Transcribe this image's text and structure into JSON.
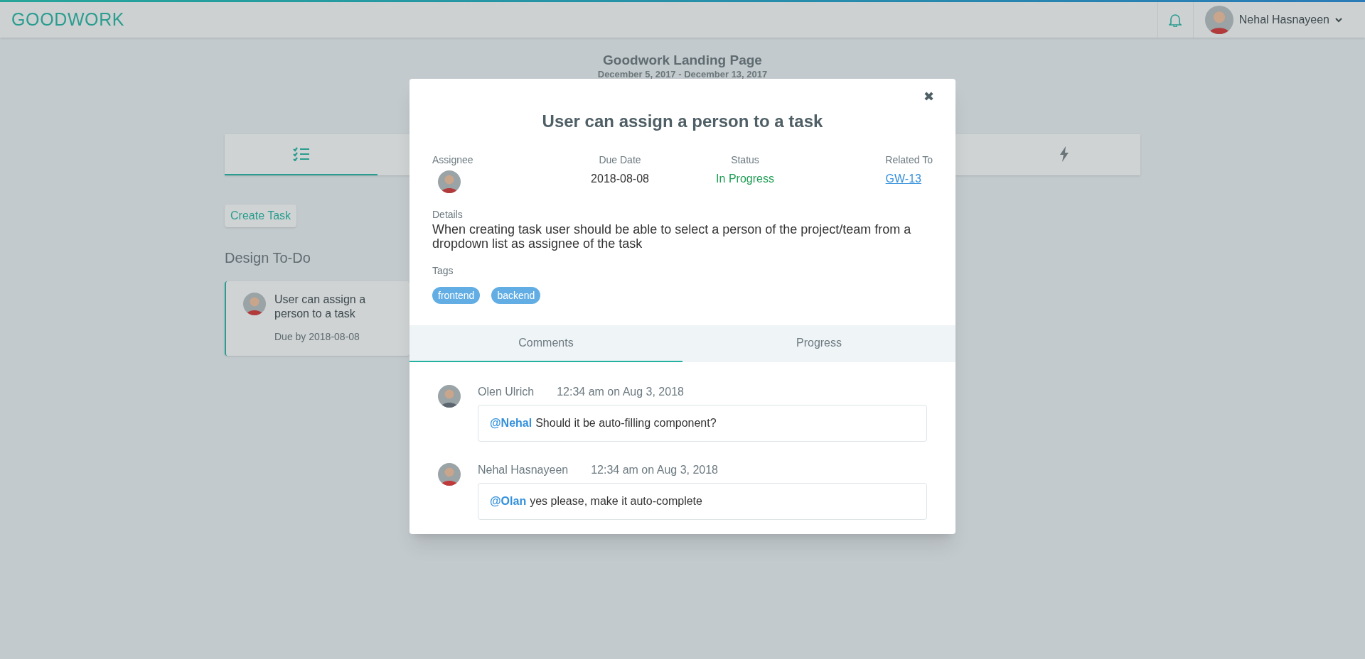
{
  "header": {
    "logo": "GOODWORK",
    "user_name": "Nehal Hasnayeen"
  },
  "project": {
    "title": "Goodwork Landing Page",
    "dates": "December 5, 2017 - December 13, 2017"
  },
  "page_tabs": [
    {
      "kind": "tasks",
      "selected": true
    },
    {
      "kind": "activity",
      "selected": false
    }
  ],
  "create_button": "Create Task",
  "group": {
    "title": "Design To-Do",
    "cards": [
      {
        "title": "User can assign a person to a task",
        "due": "Due by 2018-08-08"
      }
    ]
  },
  "modal": {
    "close": "✖",
    "title": "User can assign a person to a task",
    "fields": [
      {
        "kind": "avatar",
        "label": "Assignee"
      },
      {
        "kind": "text",
        "label": "Due Date",
        "value": "2018-08-08"
      },
      {
        "kind": "status",
        "label": "Status",
        "value": "In Progress"
      },
      {
        "kind": "link",
        "label": "Related To",
        "value": "GW-13"
      }
    ],
    "details_label": "Details",
    "details": "When creating task user should be able to select a person of the project/team from a dropdown list as assignee of the task",
    "tags_label": "Tags",
    "tags": [
      "frontend",
      "backend"
    ],
    "tabs": [
      {
        "label": "Comments",
        "selected": true
      },
      {
        "label": "Progress",
        "selected": false
      }
    ],
    "comments": [
      {
        "author": "Olen Ulrich",
        "time": "12:34 am on Aug 3, 2018",
        "mention": "@Nehal",
        "text": "Should it be auto-filling component?"
      },
      {
        "author": "Nehal Hasnayeen",
        "time": "12:34 am on Aug 3, 2018",
        "mention": "@Olan",
        "text": "yes please, make it auto-complete"
      }
    ]
  }
}
